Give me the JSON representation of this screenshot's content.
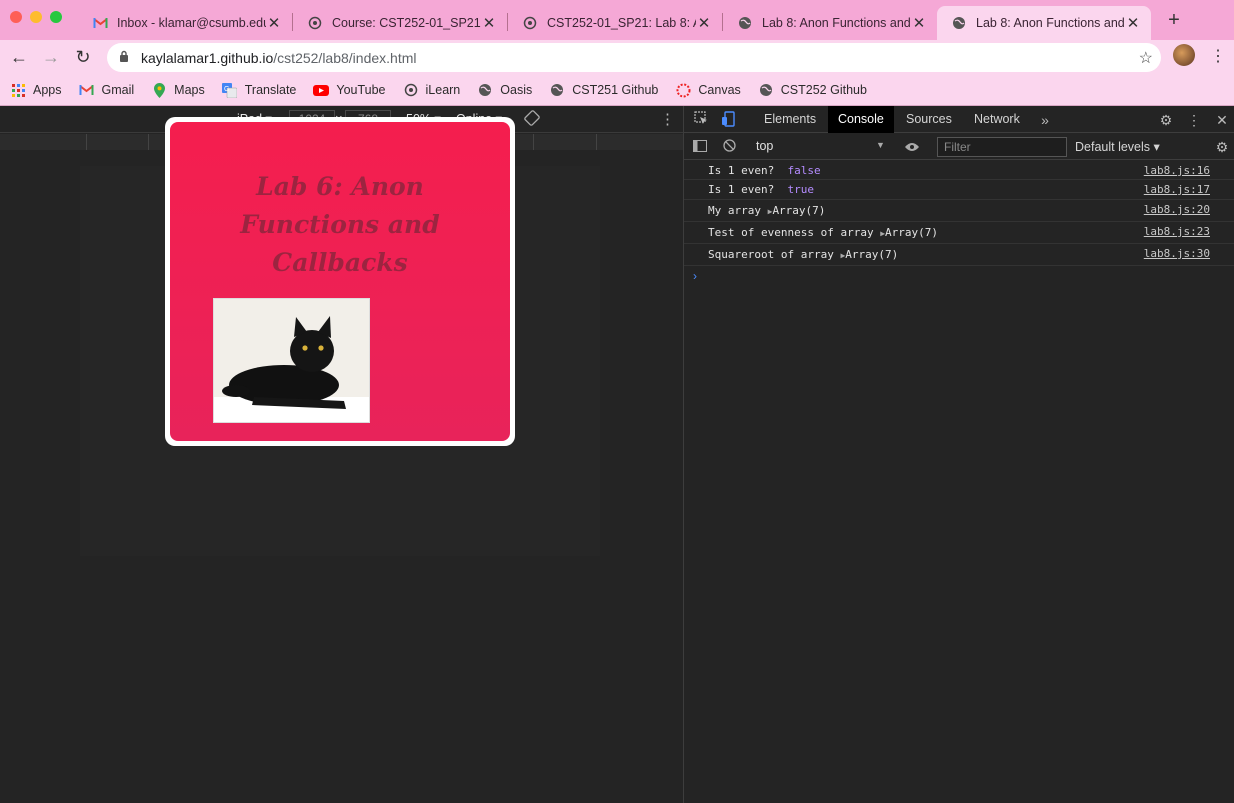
{
  "browser": {
    "tabs": [
      {
        "label": "Inbox - klamar@csumb.edu",
        "icon": "gmail-icon"
      },
      {
        "label": "Course: CST252-01_SP21:",
        "icon": "ilearn-icon"
      },
      {
        "label": "CST252-01_SP21: Lab 8: A",
        "icon": "ilearn-icon"
      },
      {
        "label": "Lab 8: Anon Functions and",
        "icon": "globe-icon"
      },
      {
        "label": "Lab 8: Anon Functions and",
        "icon": "globe-icon"
      }
    ],
    "active_tab": 4,
    "url_host": "kaylalamar1.github.io",
    "url_path": "/cst252/lab8/index.html",
    "bookmarks": [
      {
        "label": "Apps",
        "icon": "apps-grid-icon"
      },
      {
        "label": "Gmail",
        "icon": "gmail-icon"
      },
      {
        "label": "Maps",
        "icon": "maps-icon"
      },
      {
        "label": "Translate",
        "icon": "translate-icon"
      },
      {
        "label": "YouTube",
        "icon": "youtube-icon"
      },
      {
        "label": "iLearn",
        "icon": "ilearn-icon"
      },
      {
        "label": "Oasis",
        "icon": "globe-icon"
      },
      {
        "label": "CST251 Github",
        "icon": "globe-icon"
      },
      {
        "label": "Canvas",
        "icon": "canvas-icon"
      },
      {
        "label": "CST252 Github",
        "icon": "globe-icon"
      }
    ]
  },
  "device_toolbar": {
    "device": "iPad",
    "width": "1024",
    "times": "×",
    "height": "768",
    "zoom": "50%",
    "network": "Online"
  },
  "page": {
    "title_lines": [
      "Lab 6: Anon",
      "Functions and",
      "Callbacks"
    ]
  },
  "devtools": {
    "tabs": [
      "Elements",
      "Console",
      "Sources",
      "Network"
    ],
    "active_tab": "Console",
    "context": "top",
    "filter_placeholder": "Filter",
    "levels": "Default levels",
    "logs": [
      {
        "text": "Is 1 even?",
        "value": "false",
        "value_type": "bool",
        "source": "lab8.js:16"
      },
      {
        "text": "Is 1 even?",
        "value": "true",
        "value_type": "bool",
        "source": "lab8.js:17"
      },
      {
        "text": "My array",
        "value": "Array(7)",
        "value_type": "object",
        "source": "lab8.js:20"
      },
      {
        "text": "Test of evenness of array",
        "value": "Array(7)",
        "value_type": "object",
        "source": "lab8.js:23"
      },
      {
        "text": "Squareroot of array",
        "value": "Array(7)",
        "value_type": "object",
        "source": "lab8.js:30"
      }
    ]
  },
  "colors": {
    "chrome_frame": "#f5a8d6",
    "toolbar": "#fbd6ee",
    "card_red": "#f51e4e",
    "title_text": "#9c2440"
  }
}
